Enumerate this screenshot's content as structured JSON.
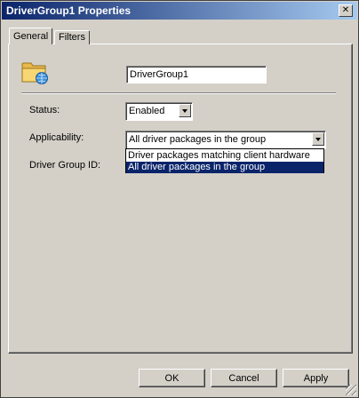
{
  "window": {
    "title": "DriverGroup1 Properties",
    "close_symbol": "✕"
  },
  "tabs": [
    {
      "label": "General",
      "selected": true
    },
    {
      "label": "Filters",
      "selected": false
    }
  ],
  "general": {
    "icon": "folder-with-globe-icon",
    "name_value": "DriverGroup1",
    "status_label": "Status:",
    "status_value": "Enabled",
    "applicability_label": "Applicability:",
    "applicability_value": "All driver packages in the group",
    "applicability_options": [
      "Driver packages matching client hardware",
      "All driver packages in the group"
    ],
    "applicability_highlighted_index": 1,
    "group_id_label": "Driver Group ID:"
  },
  "buttons": {
    "ok": "OK",
    "cancel": "Cancel",
    "apply": "Apply"
  },
  "colors": {
    "title_gradient_start": "#0a246a",
    "title_gradient_end": "#a6caf0",
    "selection": "#0a246a",
    "face": "#d4d0c8"
  }
}
